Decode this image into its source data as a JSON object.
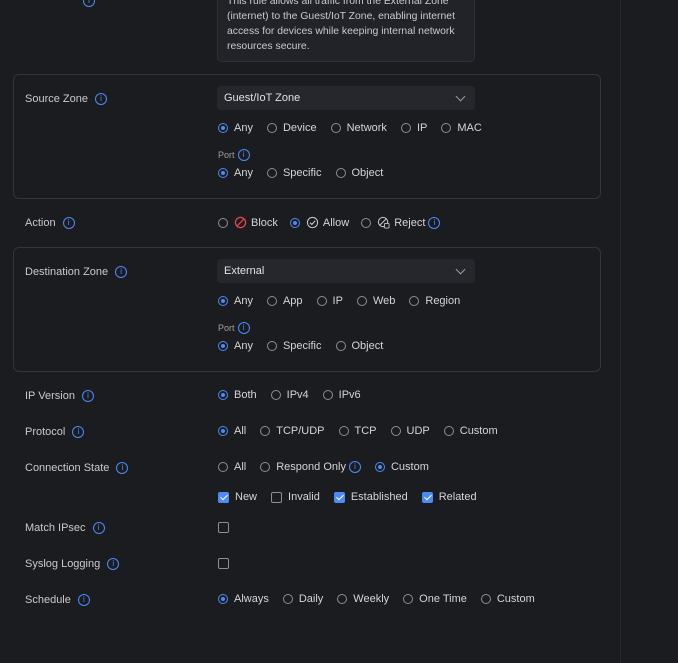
{
  "description": {
    "lines": [
      "This rule allows all traffic from the External Zone",
      "(internet) to the Guest/IoT Zone, enabling internet",
      "access for devices while keeping internal network",
      "resources secure."
    ]
  },
  "source_zone": {
    "label": "Source Zone",
    "selected": "Guest/IoT Zone",
    "match_options": [
      "Any",
      "Device",
      "Network",
      "IP",
      "MAC"
    ],
    "match_selected": "Any",
    "port_label": "Port",
    "port_options": [
      "Any",
      "Specific",
      "Object"
    ],
    "port_selected": "Any"
  },
  "action": {
    "label": "Action",
    "options": [
      {
        "label": "Block",
        "icon": "block-icon"
      },
      {
        "label": "Allow",
        "icon": "allow-icon"
      },
      {
        "label": "Reject",
        "icon": "reject-icon"
      }
    ],
    "selected": "Allow"
  },
  "destination_zone": {
    "label": "Destination Zone",
    "selected": "External",
    "match_options": [
      "Any",
      "App",
      "IP",
      "Web",
      "Region"
    ],
    "match_selected": "Any",
    "port_label": "Port",
    "port_options": [
      "Any",
      "Specific",
      "Object"
    ],
    "port_selected": "Any"
  },
  "ip_version": {
    "label": "IP Version",
    "options": [
      "Both",
      "IPv4",
      "IPv6"
    ],
    "selected": "Both"
  },
  "protocol": {
    "label": "Protocol",
    "options": [
      "All",
      "TCP/UDP",
      "TCP",
      "UDP",
      "Custom"
    ],
    "selected": "All"
  },
  "connection_state": {
    "label": "Connection State",
    "options": [
      "All",
      "Respond Only",
      "Custom"
    ],
    "selected": "Custom",
    "states": [
      {
        "label": "New",
        "checked": true
      },
      {
        "label": "Invalid",
        "checked": false
      },
      {
        "label": "Established",
        "checked": true
      },
      {
        "label": "Related",
        "checked": true
      }
    ]
  },
  "match_ipsec": {
    "label": "Match IPsec",
    "checked": false
  },
  "syslog_logging": {
    "label": "Syslog Logging",
    "checked": false
  },
  "schedule": {
    "label": "Schedule",
    "options": [
      "Always",
      "Daily",
      "Weekly",
      "One Time",
      "Custom"
    ],
    "selected": "Always"
  },
  "colors": {
    "accent": "#4c8bf5",
    "background": "#1b1c20",
    "block": "#e5484d"
  }
}
